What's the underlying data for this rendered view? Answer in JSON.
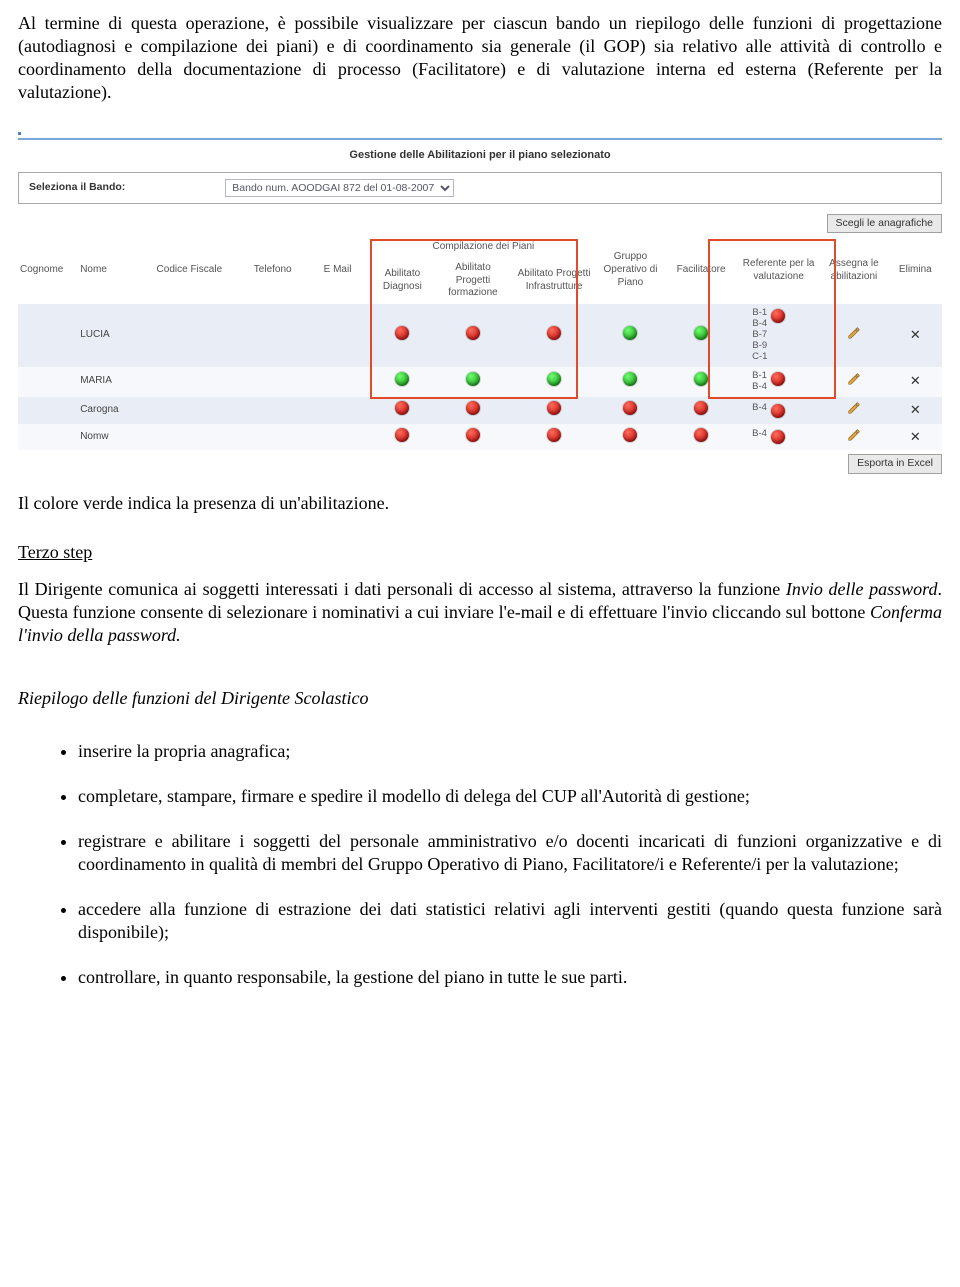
{
  "intro_para": "Al termine di questa operazione, è possibile visualizzare per ciascun bando un riepilogo delle funzioni di progettazione (autodiagnosi e compilazione dei piani) e di coordinamento sia generale (il GOP) sia relativo alle attività di controllo e coordinamento della documentazione di processo (Facilitatore)  e di valutazione interna ed esterna (Referente per la valutazione).",
  "app": {
    "section_title": "Gestione delle Abilitazioni per il piano selezionato",
    "bando_label": "Seleziona il Bando:",
    "bando_selected": "Bando num. AOODGAI 872 del 01-08-2007",
    "btn_scegli": "Scegli le anagrafiche",
    "btn_esporta": "Esporta in Excel",
    "headers": {
      "cognome": "Cognome",
      "nome": "Nome",
      "codice_fiscale": "Codice Fiscale",
      "telefono": "Telefono",
      "email": "E Mail",
      "comp_piani": "Compilazione dei Piani",
      "ab_diag": "Abilitato Diagnosi",
      "ab_form": "Abilitato Progetti formazione",
      "ab_infra": "Abilitato Progetti Infrastrutture",
      "gruppo": "Gruppo Operativo di Piano",
      "facilitatore": "Facilitatore",
      "referente": "Referente per la valutazione",
      "assegna": "Assegna le abilitazioni",
      "elimina": "Elimina"
    },
    "rows": [
      {
        "nome": "LUCIA",
        "dots": [
          "red",
          "red",
          "red",
          "green",
          "green"
        ],
        "ref_codes": "B-1\nB-4\nB-7\nB-9\nC-1",
        "ref_dot": "red"
      },
      {
        "nome": "MARIA",
        "dots": [
          "green",
          "green",
          "green",
          "green",
          "green"
        ],
        "ref_codes": "B-1\nB-4",
        "ref_dot": "red"
      },
      {
        "nome": "Carogna",
        "dots": [
          "red",
          "red",
          "red",
          "red",
          "red"
        ],
        "ref_codes": "B-4",
        "ref_dot": "red"
      },
      {
        "nome": "Nomw",
        "dots": [
          "red",
          "red",
          "red",
          "red",
          "red"
        ],
        "ref_codes": "B-4",
        "ref_dot": "red"
      }
    ]
  },
  "green_note": "Il colore verde indica la presenza di un'abilitazione.",
  "step_label": "Terzo step",
  "step_para_a": "Il Dirigente comunica ai soggetti interessati i dati personali di accesso al sistema, attraverso la funzione ",
  "step_para_b": "Invio delle password",
  "step_para_c": ". Questa funzione consente di selezionare i nominativi a cui inviare l'e-mail e di effettuare l'invio cliccando sul bottone ",
  "step_para_d": "Conferma l'invio della password.",
  "riepilogo_title": "Riepilogo delle funzioni del Dirigente Scolastico",
  "bullets": [
    "inserire la propria anagrafica;",
    "completare, stampare, firmare e spedire il modello di delega del CUP all'Autorità di gestione;",
    "registrare e abilitare i soggetti del personale amministrativo e/o docenti incaricati di funzioni organizzative e di coordinamento in qualità di membri del Gruppo Operativo di Piano, Facilitatore/i e Referente/i per la valutazione;",
    "accedere alla funzione di estrazione dei dati statistici relativi agli interventi gestiti (quando questa funzione sarà disponibile);",
    "controllare, in quanto responsabile, la gestione del piano in tutte le sue parti."
  ]
}
